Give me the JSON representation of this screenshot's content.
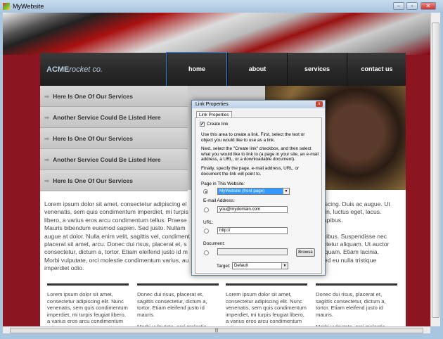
{
  "window": {
    "title": "MyWebsite",
    "minimize": "–",
    "maximize": "▫",
    "close": "✕"
  },
  "site": {
    "logo_bold": "ACME",
    "logo_italic": "rocket co.",
    "nav": [
      "home",
      "about",
      "services",
      "contact us"
    ],
    "services": [
      "Here Is One Of Our Services",
      "Another Service Could Be Listed Here",
      "Here Is One Of Our Services",
      "Another Service Could Be Listed Here",
      "Here Is One Of Our Services"
    ],
    "body_left": [
      "Lorem ipsum dolor sit amet, consectetur adipiscing el",
      "venenatis, sem quis condimentum imperdiet, mi turpis",
      "libero, a varius eros arcu condimentum tellus. Praese",
      "Mauris bibendum euismod sapien. Sed justo. Nullam",
      "augue at dolor. Nulla enim velit, sagittis vel, condiment",
      "placerat sit amet, arcu. Donec dui risus, placerat et, s",
      "consectetur, dictum a, tortor. Etiam eleifend justo id m",
      "Morbi vulputate, orci molestie condimentum varius, au",
      "imperdiet odio."
    ],
    "body_right": [
      "piscing. Duis ac augue. Ut",
      "n in, luctus eget, lacus.",
      "dapibus.",
      "",
      "ucibus. Suspendisse nec",
      "ectetur aliquam. Ut auctor",
      "it quam. Etiam lacinia.",
      "Sed eu nulla tristique",
      ""
    ],
    "columns": [
      [
        "Lorem ipsum dolor sit amet, consectetur adipiscing elit. Nunc venenatis, sem quis condimentum imperdiet, mi turpis feugiat libero, a varius eros arcu condimentum tellus. Praesent eros. Mauris"
      ],
      [
        "Donec dui risus, placerat et, sagittis consectetur, dictum a, tortor. Etiam eleifend justo id mauris.",
        "Morbi vulputate, orci molestie"
      ],
      [
        "Lorem ipsum dolor sit amet, consectetur adipiscing elit. Nunc venenatis, sem quis condimentum imperdiet, mi turpis feugiat libero, a varius eros arcu condimentum tellus. Praesent eros. Mauris"
      ],
      [
        "Donec dui risus, placerat et, sagittis consectetur, dictum a, tortor. Etiam eleifend justo id mauris.",
        "Morbi vulputate, orci molestie"
      ]
    ]
  },
  "dialog": {
    "title": "Link Properties",
    "close": "x",
    "tab": "Link Properties",
    "create_link": "Create link",
    "create_link_checked": true,
    "para1": "Use this area to create a link. First, select the text or object you would like to use as a link.",
    "para2": "Next, select the \"Create link\" checkbox, and then select what you would like to link to (a page in your site, an e-mail address, a URL, or a downloadable document).",
    "para3": "Finally, specify the page, e-mail address, URL, or document the link will point to.",
    "page_label": "Page in This Website:",
    "page_value": "MyWebsite (front page)",
    "email_label": "E-mail Address:",
    "email_value": "you@mydomain.com",
    "url_label": "URL:",
    "url_value": "http://",
    "doc_label": "Document:",
    "doc_value": "",
    "browse": "Browse",
    "target_label": "Target:",
    "target_value": "Default",
    "selected_option": "page"
  },
  "colors": {
    "accent": "#2b7de0",
    "frame": "#8c1522",
    "nav": "#2a2a2a"
  }
}
